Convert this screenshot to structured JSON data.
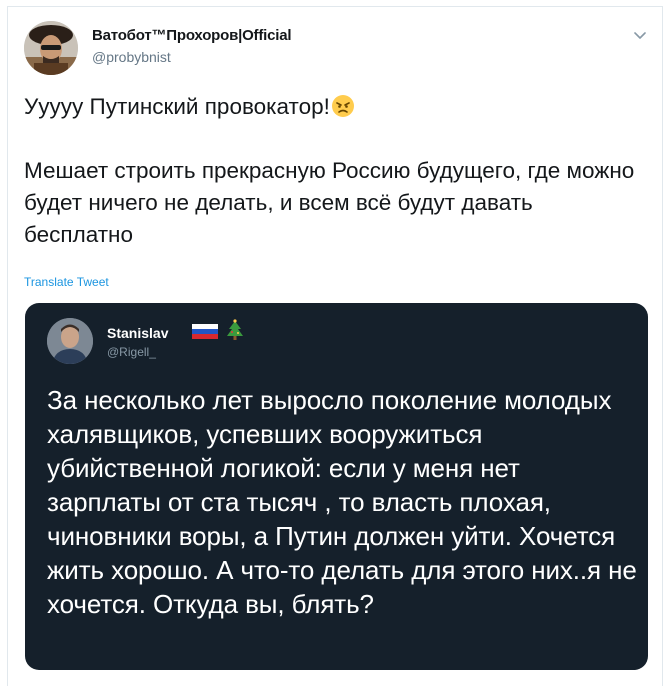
{
  "tweet": {
    "author_name": "Ватобот™Прохоров|Official",
    "author_handle": "@probybnist",
    "text_line1": "Ууууу Путинский провокатор!",
    "emoji": "angry-face",
    "text_para2": "Мешает строить прекрасную Россию будущего, где можно будет ничего не делать, и всем всё будут давать бесплатно",
    "translate_label": "Translate Tweet"
  },
  "quoted": {
    "author_name": "Stanislav",
    "flag": "russia-flag",
    "emoji": "christmas-tree",
    "author_handle": "@Rigell_",
    "text": "За несколько лет выросло поколение молодых халявщиков, успевших вооружиться убийственной логикой: если у меня нет зарплаты от ста тысяч , то власть плохая, чиновники воры, а Путин должен уйти. Хочется жить хорошо. А что-то делать для этого них..я не хочется. Откуда вы, блять?"
  },
  "colors": {
    "link": "#1b95e0",
    "quote_bg": "#15202b",
    "text": "#14171a",
    "muted": "#657786"
  }
}
